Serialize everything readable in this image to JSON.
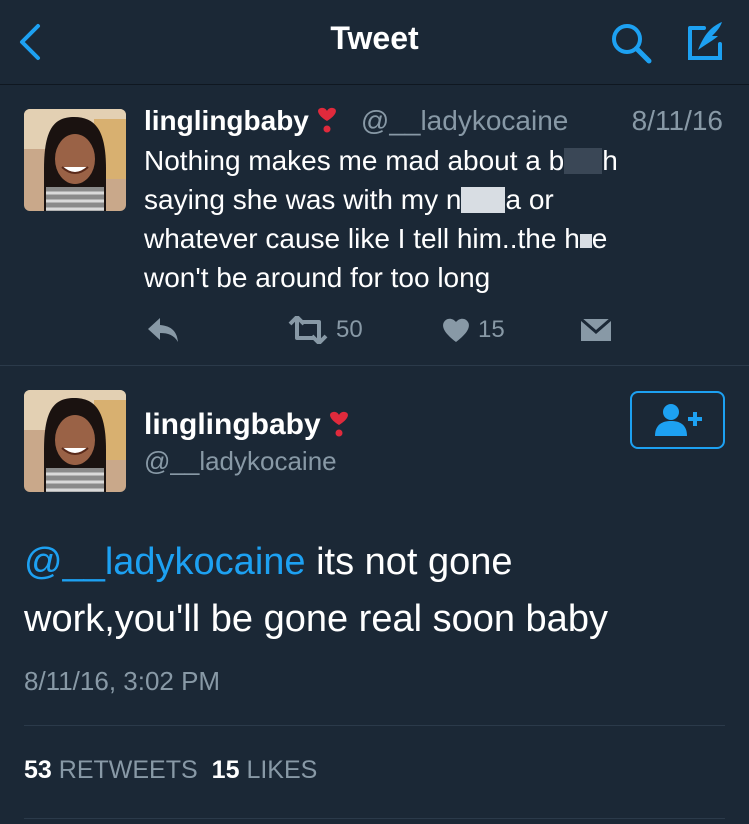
{
  "header": {
    "title": "Tweet",
    "back_icon": "chevron-left-icon",
    "search_icon": "search-icon",
    "compose_icon": "compose-icon",
    "accent": "#1da1f2"
  },
  "parent_tweet": {
    "name": "linglingbaby",
    "name_emoji": "heavy-heart-exclamation-icon",
    "handle": "@__ladykocaine",
    "date": "8/11/16",
    "text_line1_a": "Nothing makes me mad about a b",
    "text_line1_b": "h",
    "text_line2_a": "saying she was with my n",
    "text_line2_b": "a or",
    "text_line3_a": "whatever cause like I tell him..the h",
    "text_line3_b": "e",
    "text_line4": "won't be around for too long",
    "retweets": "50",
    "likes": "15"
  },
  "main_tweet": {
    "name": "linglingbaby",
    "name_emoji": "heavy-heart-exclamation-icon",
    "handle": "@__ladykocaine",
    "mention": "@__ladykocaine",
    "text_a": " its not gone",
    "text_b": "work,you'll be gone real soon baby",
    "timestamp": "8/11/16, 3:02 PM",
    "retweet_count": "53",
    "retweet_label": "RETWEETS",
    "like_count": "15",
    "like_label": "LIKES",
    "follow_icon": "add-user-icon"
  }
}
